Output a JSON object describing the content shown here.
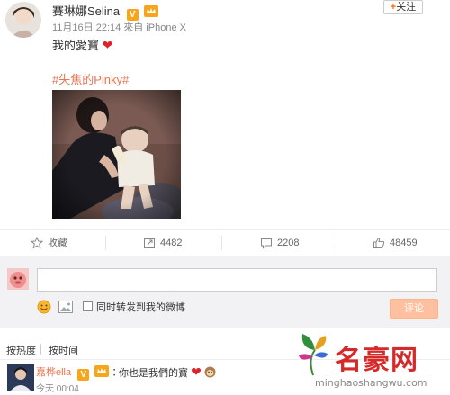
{
  "post": {
    "username": "賽琳娜Selina",
    "badge_v": "V",
    "timestamp": "11月16日 22:14",
    "source": "來自 iPhone X",
    "follow_label": "关注",
    "text": "我的愛寶",
    "hashtag": "#失焦的Pinky#"
  },
  "actions": {
    "favorite": "收藏",
    "repost_count": "4482",
    "comment_count": "2208",
    "like_count": "48459"
  },
  "composer": {
    "input_value": "",
    "repost_label": "同时转发到我的微博",
    "submit_label": "评论"
  },
  "sort": {
    "by_heat": "按热度",
    "by_time": "按时间"
  },
  "comment": {
    "user": "嘉桦ella",
    "badge_v": "V",
    "text": "你也是我們的寶",
    "time": "今天 00:04"
  },
  "watermark": {
    "title": "名豪网",
    "url": "minghaoshangwu.com"
  },
  "colors": {
    "accent": "#eb7350",
    "badge": "#f7a51a",
    "heart": "#e0202a",
    "submit_bg": "#ffc09f",
    "composer_bg": "#f2f2f5"
  }
}
